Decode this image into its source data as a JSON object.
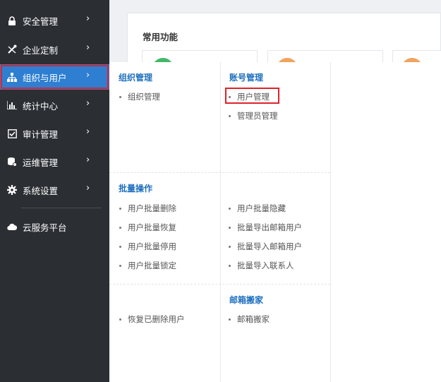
{
  "sidebar": {
    "items": [
      {
        "label": "安全管理",
        "icon": "lock-icon",
        "arrow": "›"
      },
      {
        "label": "企业定制",
        "icon": "tools-icon",
        "arrow": "›"
      },
      {
        "label": "组织与用户",
        "icon": "org-chart-icon",
        "arrow": "›",
        "active": true
      },
      {
        "label": "统计中心",
        "icon": "bar-chart-icon",
        "arrow": "›"
      },
      {
        "label": "审计管理",
        "icon": "audit-checkbox-icon",
        "arrow": "›"
      },
      {
        "label": "运维管理",
        "icon": "database-gear-icon",
        "arrow": "›"
      },
      {
        "label": "系统设置",
        "icon": "gear-icon",
        "arrow": "›"
      },
      {
        "label": "云服务平台",
        "icon": "cloud-icon"
      }
    ]
  },
  "main": {
    "title": "常用功能",
    "card_colors": [
      "#43b86a",
      "#f0a460",
      "#f0a460"
    ]
  },
  "flyout": {
    "org": {
      "title": "组织管理",
      "items": [
        "组织管理"
      ]
    },
    "account": {
      "title": "账号管理",
      "items": [
        "用户管理",
        "管理员管理"
      ]
    },
    "batch": {
      "title": "批量操作",
      "left_items": [
        "用户批量删除",
        "用户批量恢复",
        "用户批量停用",
        "用户批量锁定"
      ],
      "right_items": [
        "用户批量隐藏",
        "批量导出邮箱用户",
        "批量导入邮箱用户",
        "批量导入联系人"
      ]
    },
    "restore": {
      "items": [
        "恢复已删除用户"
      ]
    },
    "mailbox_move": {
      "title": "邮箱搬家",
      "items": [
        "邮箱搬家"
      ]
    }
  },
  "colors": {
    "sidebar_bg": "#2b2e33",
    "active_bg": "#2e7fd1",
    "highlight": "#e0222a",
    "section_title": "#1f6fbf"
  }
}
